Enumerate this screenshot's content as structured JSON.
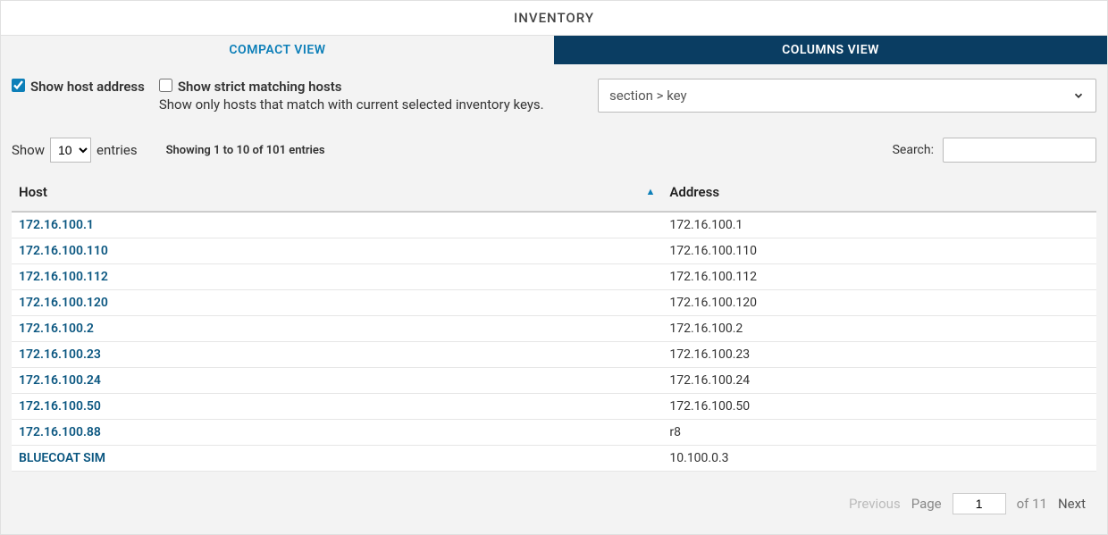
{
  "title": "INVENTORY",
  "tabs": {
    "compact": "COMPACT VIEW",
    "columns": "COLUMNS VIEW"
  },
  "controls": {
    "show_host_address_label": "Show host address",
    "show_host_address_checked": true,
    "strict_label": "Show strict matching hosts",
    "strict_help": "Show only hosts that match with current selected inventory keys.",
    "strict_checked": false,
    "section_key_placeholder": "section > key"
  },
  "entries": {
    "show_label": "Show",
    "entries_label": "entries",
    "selected": "10",
    "info": "Showing 1 to 10 of 101 entries"
  },
  "search": {
    "label": "Search:",
    "value": ""
  },
  "table": {
    "headers": {
      "host": "Host",
      "address": "Address"
    },
    "rows": [
      {
        "host": "172.16.100.1",
        "address": "172.16.100.1"
      },
      {
        "host": "172.16.100.110",
        "address": "172.16.100.110"
      },
      {
        "host": "172.16.100.112",
        "address": "172.16.100.112"
      },
      {
        "host": "172.16.100.120",
        "address": "172.16.100.120"
      },
      {
        "host": "172.16.100.2",
        "address": "172.16.100.2"
      },
      {
        "host": "172.16.100.23",
        "address": "172.16.100.23"
      },
      {
        "host": "172.16.100.24",
        "address": "172.16.100.24"
      },
      {
        "host": "172.16.100.50",
        "address": "172.16.100.50"
      },
      {
        "host": "172.16.100.88",
        "address": "r8"
      },
      {
        "host": "BLUECOAT SIM",
        "address": "10.100.0.3"
      }
    ]
  },
  "pager": {
    "previous": "Previous",
    "page_label": "Page",
    "page": "1",
    "of_label": "of 11",
    "next": "Next"
  }
}
